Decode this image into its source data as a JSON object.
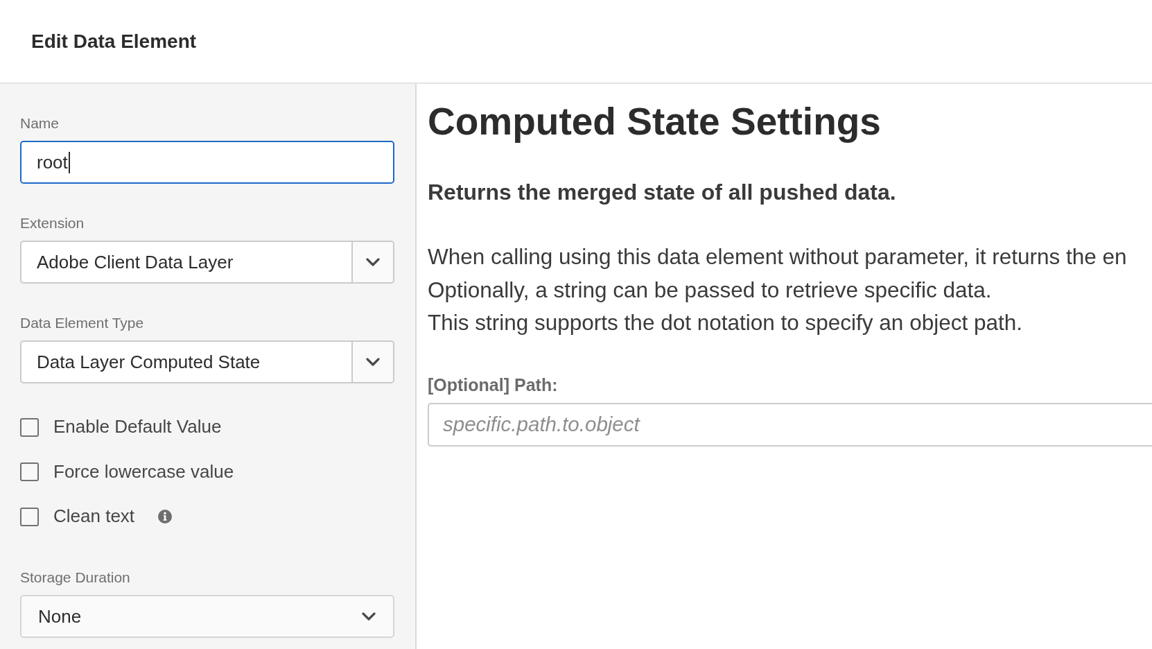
{
  "header": {
    "title": "Edit Data Element"
  },
  "form": {
    "controls": [
      {
        "kind": "text",
        "label": "Name",
        "value": "root",
        "focused": true
      },
      {
        "kind": "combobox",
        "label": "Extension",
        "value": "Adobe Client Data Layer"
      },
      {
        "kind": "combobox",
        "label": "Data Element Type",
        "value": "Data Layer Computed State"
      },
      {
        "kind": "checkbox",
        "label": "Enable Default Value",
        "checked": false
      },
      {
        "kind": "checkbox",
        "label": "Force lowercase value",
        "checked": false
      },
      {
        "kind": "checkbox",
        "label": "Clean text",
        "checked": false,
        "info": true
      },
      {
        "kind": "select",
        "label": "Storage Duration",
        "value": "None"
      }
    ]
  },
  "settings": {
    "title": "Computed State Settings",
    "summary": "Returns the merged state of all pushed data.",
    "description_lines": [
      "When calling using this data element without parameter, it returns the en",
      "Optionally, a string can be passed to retrieve specific data.",
      "This string supports the dot notation to specify an object path."
    ],
    "path_field": {
      "label": "[Optional] Path:",
      "placeholder": "specific.path.to.object"
    }
  }
}
